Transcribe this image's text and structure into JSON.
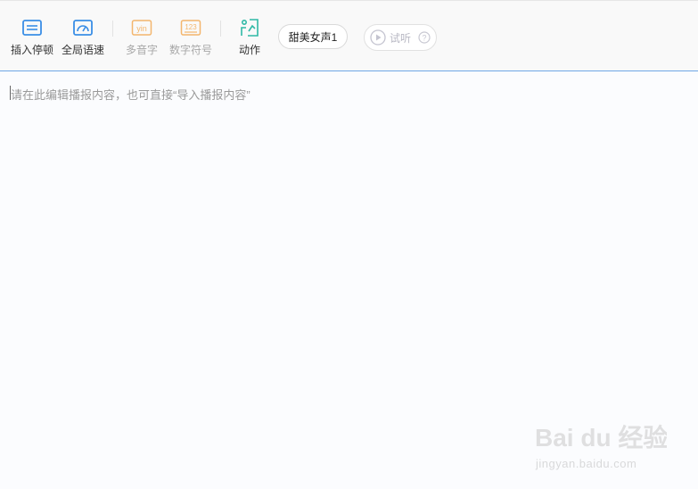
{
  "toolbar": {
    "insert_pause": "插入停顿",
    "global_speed": "全局语速",
    "polyphone": "多音字",
    "polyphone_icon_text": "yin",
    "digit_symbol": "数字符号",
    "digit_symbol_icon_text": "123",
    "action": "动作",
    "voice_select": "甜美女声1",
    "listen": "试听",
    "help_glyph": "?"
  },
  "editor": {
    "placeholder": "请在此编辑播报内容，也可直接“导入播报内容”"
  },
  "watermark": {
    "line1": "Bai du 经验",
    "line2": "jingyan.baidu.com"
  },
  "colors": {
    "accent_blue": "#3a8ee6",
    "disabled_orange": "#f3b66d",
    "action_teal": "#2fb9a6",
    "toolbar_border": "#6fa7e6"
  }
}
